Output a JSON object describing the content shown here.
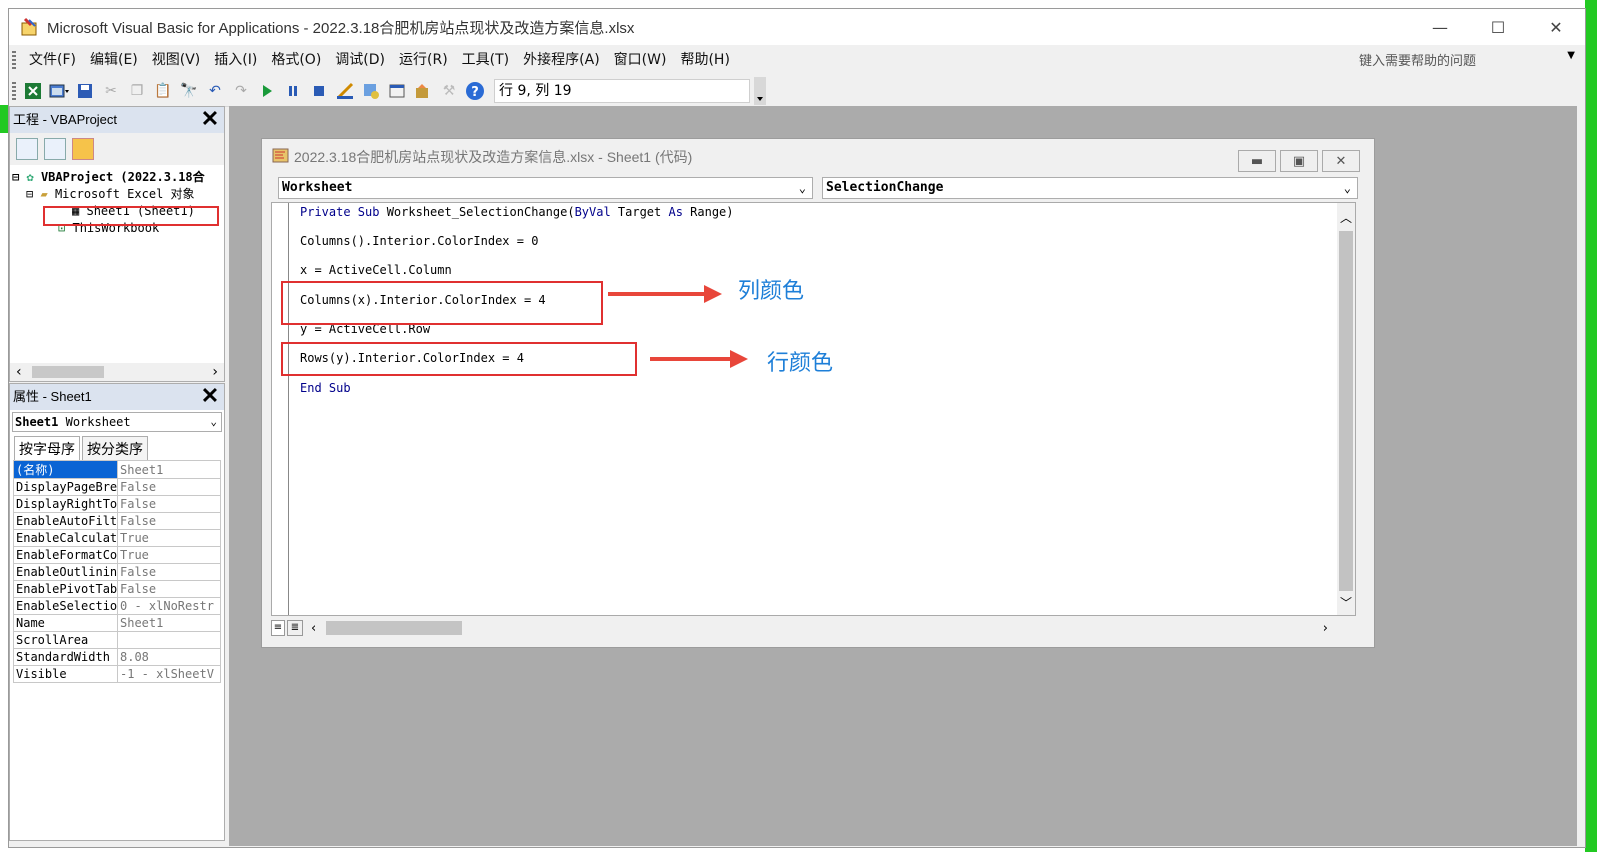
{
  "window": {
    "title": "Microsoft Visual Basic for Applications - 2022.3.18合肥机房站点现状及改造方案信息.xlsx",
    "minimize": "—",
    "maximize": "☐",
    "close": "✕"
  },
  "menu": {
    "items": [
      "文件(F)",
      "编辑(E)",
      "视图(V)",
      "插入(I)",
      "格式(O)",
      "调试(D)",
      "运行(R)",
      "工具(T)",
      "外接程序(A)",
      "窗口(W)",
      "帮助(H)"
    ],
    "help_placeholder": "键入需要帮助的问题"
  },
  "toolbar": {
    "position": "行 9, 列 19"
  },
  "project": {
    "title": "工程 - VBAProject",
    "root": "VBAProject (2022.3.18合",
    "folder": "Microsoft Excel 对象",
    "sheet": "Sheet1 (Sheet1)",
    "workbook": "ThisWorkbook"
  },
  "properties": {
    "title": "属性 - Sheet1",
    "object_name": "Sheet1",
    "object_type": "Worksheet",
    "tab_alpha": "按字母序",
    "tab_category": "按分类序",
    "rows": [
      {
        "name": "(名称)",
        "value": "Sheet1"
      },
      {
        "name": "DisplayPageBre",
        "value": "False"
      },
      {
        "name": "DisplayRightTo",
        "value": "False"
      },
      {
        "name": "EnableAutoFilt",
        "value": "False"
      },
      {
        "name": "EnableCalculat",
        "value": "True"
      },
      {
        "name": "EnableFormatCo",
        "value": "True"
      },
      {
        "name": "EnableOutlinin",
        "value": "False"
      },
      {
        "name": "EnablePivotTab",
        "value": "False"
      },
      {
        "name": "EnableSelectio",
        "value": "0 - xlNoRestr"
      },
      {
        "name": "Name",
        "value": "Sheet1"
      },
      {
        "name": "ScrollArea",
        "value": ""
      },
      {
        "name": "StandardWidth",
        "value": "8.08"
      },
      {
        "name": "Visible",
        "value": "-1 - xlSheetV"
      }
    ]
  },
  "code_window": {
    "title": "2022.3.18合肥机房站点现状及改造方案信息.xlsx - Sheet1 (代码)",
    "object_combo": "Worksheet",
    "proc_combo": "SelectionChange",
    "lines": {
      "l1_kw1": "Private Sub",
      "l1_mid": " Worksheet_SelectionChange(",
      "l1_kw2": "ByVal",
      "l1_mid2": " Target ",
      "l1_kw3": "As",
      "l1_end": " Range)",
      "l2": "Columns().Interior.ColorIndex = 0",
      "l3": "x = ActiveCell.Column",
      "l4": "Columns(x).Interior.ColorIndex = 4",
      "l5": "y = ActiveCell.Row",
      "l6": "Rows(y).Interior.ColorIndex = 4",
      "l7": "End Sub"
    }
  },
  "annotations": {
    "col_color": "列颜色",
    "row_color": "行颜色"
  },
  "colors": {
    "accent_red": "#e03030",
    "annotation_blue": "#1e7fd8",
    "keyword_blue": "#00008b",
    "selection_blue": "#0a64d4"
  }
}
